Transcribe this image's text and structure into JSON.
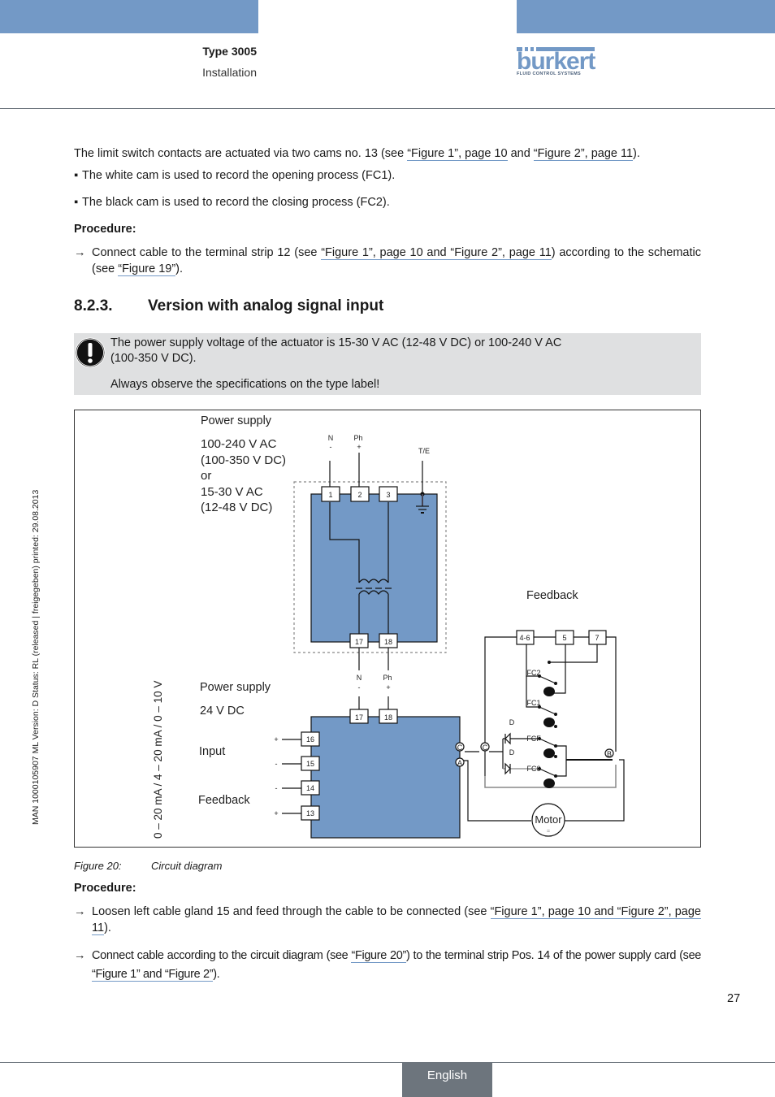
{
  "header": {
    "title": "Type 3005",
    "subtitle": "Installation",
    "logo": {
      "word": "bürkert",
      "word_base": "burkert",
      "tagline": "FLUID CONTROL SYSTEMS"
    },
    "band_color": "#7399c6"
  },
  "side_note": "MAN  1000105907  ML  Version: D  Status: RL (released | freigegeben)  printed: 29.08.2013",
  "intro": {
    "text_before": "The limit switch contacts are actuated via two cams no. 13 (see ",
    "link1": "“Figure 1”, page 10",
    "text_mid": " and ",
    "link2": "“Figure 2”, page 11",
    "text_after": ")."
  },
  "bullets": [
    "The white cam is used to record the opening process (FC1).",
    "The black cam is used to record the closing process (FC2)."
  ],
  "procedure1": {
    "label": "Procedure:",
    "step": {
      "arrow": "→",
      "text_before": "Connect cable to the terminal strip 12 (see ",
      "link": "“Figure 1”, page 10 and “Figure 2”, page 11",
      "text_mid": ") according to the schematic (see ",
      "link2": "“Figure 19”",
      "text_after": ")."
    }
  },
  "section": {
    "number": "8.2.3.",
    "title": "Version with analog signal input"
  },
  "note": {
    "icon": "exclamation-icon",
    "line1": "The power supply voltage of the actuator is 15-30 V AC (12-48 V DC) or 100-240 V AC",
    "line2": "(100-350 V DC).",
    "line3": "Always observe the specifications on the type label!"
  },
  "diagram": {
    "power_supply_top": {
      "title": "Power supply",
      "line1": "100-240 V AC",
      "line2": "(100-350 V DC)",
      "line3": "or",
      "line4": "15-30 V AC",
      "line5": "(12-48 V DC)"
    },
    "top_wires": {
      "n": "N",
      "n_sign": "-",
      "ph": "Ph",
      "ph_sign": "+",
      "te": "T/E"
    },
    "top_terminals": [
      "1",
      "2",
      "3"
    ],
    "top_out_terminals": [
      "17",
      "18"
    ],
    "mid_wires": {
      "n": "N",
      "n_sign": "-",
      "ph": "Ph",
      "ph_sign": "+"
    },
    "power_supply_bottom": {
      "title": "Power supply",
      "line1": "24 V DC"
    },
    "bottom_terminals": [
      "17",
      "18"
    ],
    "left_terminals": [
      {
        "num": "16",
        "sign": "+"
      },
      {
        "num": "15",
        "sign": "-"
      },
      {
        "num": "14",
        "sign": "-"
      },
      {
        "num": "13",
        "sign": "+"
      }
    ],
    "input_label": "Input",
    "feedback_label_left": "Feedback",
    "signal_label": "0 – 20 mA / 4 – 20 mA / 0 – 10 V",
    "feedback_label_right": "Feedback",
    "feedback_terminals": [
      "4-6",
      "5",
      "7"
    ],
    "switches": [
      "FC2",
      "FC1",
      "FCF",
      "FC0"
    ],
    "diode_label": "D",
    "nodes": {
      "c": "C",
      "a": "A",
      "b": "B"
    },
    "motor": {
      "label": "Motor",
      "symbol": "="
    },
    "box_color": "#7399c6"
  },
  "figure_caption": {
    "number": "Figure 20:",
    "title": "Circuit diagram"
  },
  "procedure2": {
    "label": "Procedure:",
    "steps": [
      {
        "arrow": "→",
        "text_before": "Loosen left cable gland 15 and feed through the cable to be connected (see ",
        "link": "“Figure 1”, page 10 and “Figure 2”, page 11",
        "text_after": ")."
      },
      {
        "arrow": "→",
        "text_before": "Connect cable according to the circuit diagram (see ",
        "link": "“Figure 20”",
        "text_mid": ") to the terminal strip Pos. 14 of the power supply card (see ",
        "link2": "“Figure 1” and “Figure 2”",
        "text_after": ")."
      }
    ]
  },
  "footer": {
    "page_number": "27",
    "language": "English"
  }
}
